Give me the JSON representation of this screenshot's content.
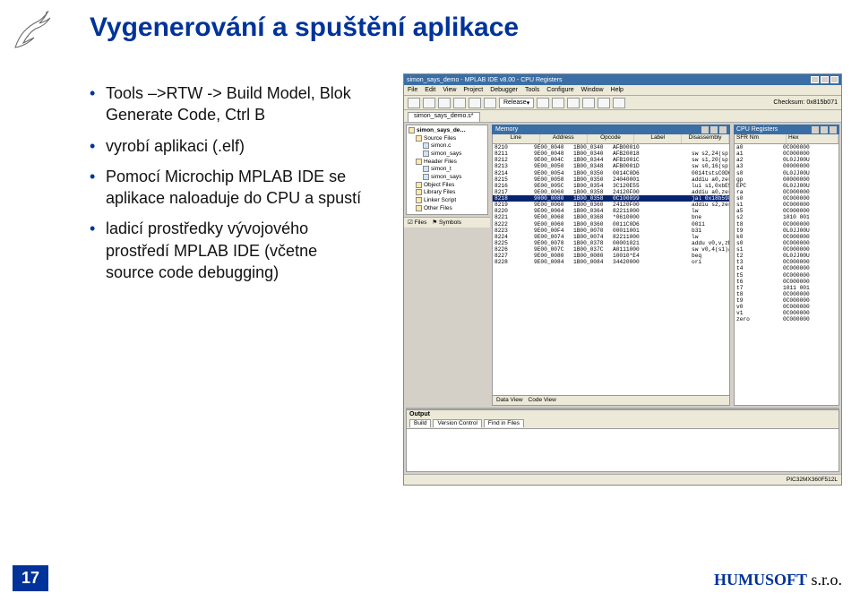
{
  "title": "Vygenerování a spuštění aplikace",
  "bullets": [
    "Tools –>RTW -> Build Model, Blok Generate Code, Ctrl B",
    "vyrobí aplikaci (.elf)",
    "Pomocí Microchip MPLAB IDE se aplikace naloaduje do CPU a spustí",
    "ladicí prostředky vývojového prostředí MPLAB IDE (včetne source code debugging)"
  ],
  "page_number": "17",
  "brand_main": "HUMUSOFT",
  "brand_suffix": " s.r.o.",
  "ide": {
    "window_title": "simon_says_demo - MPLAB IDE v8.00 - CPU Registers",
    "menu": [
      "File",
      "Edit",
      "View",
      "Project",
      "Debugger",
      "Tools",
      "Configure",
      "Window",
      "Help"
    ],
    "toolbar_combo": "Release",
    "checksum_label": "Checksum: 0x815b071",
    "doc_tab": "simon_says_demo.s*",
    "tree_tabs": [
      "Files",
      "Symbols"
    ],
    "tree": [
      "simon_says_de…",
      "Source Files",
      "simon.c",
      "simon_says",
      "Header Files",
      "simon_t",
      "simon_says",
      "Object Files",
      "Library Files",
      "Linker Script",
      "Other Files"
    ],
    "mem": {
      "title": "Memory",
      "headers": [
        "Line",
        "Address",
        "Opcode",
        "Label",
        "Disassembly"
      ],
      "rows": [
        [
          "8210",
          "9E00_0040",
          "1B00_0340",
          "AFB00010",
          "",
          ""
        ],
        [
          "8211",
          "9E00_0048",
          "1B00_0340",
          "AFB20018",
          "",
          "sw  s2,24(sp)"
        ],
        [
          "8212",
          "9E00_004C",
          "1B00_0344",
          "AFB1001C",
          "",
          "sw  s1,20(sp)"
        ],
        [
          "8213",
          "9E00_0050",
          "1B00_0348",
          "AFB0001D",
          "",
          "sw  s0,16(sp)"
        ],
        [
          "8214",
          "9E00_0054",
          "1B00_0350",
          "0014C0D6",
          "",
          "0014tstsC0D6"
        ],
        [
          "8215",
          "9E00_0058",
          "1B00_0350",
          "24040001",
          "",
          "addiu a0,zero,1"
        ],
        [
          "8216",
          "9E00_005C",
          "1B00_0354",
          "3C120E55",
          "",
          "lui  s1,0xbE55"
        ],
        [
          "8217",
          "9E00_0060",
          "1B00_0358",
          "24120F00",
          "",
          "addiu a0,zero,…?"
        ],
        [
          "8218",
          "9000_0080",
          "1B00_0358",
          "0C100899",
          "",
          "jal  0x18b598"
        ],
        [
          "8219",
          "9E00_0060",
          "1B00_0360",
          "24120F00",
          "",
          "addiu s2,zero,…0"
        ],
        [
          "8220",
          "9E00_0064",
          "1B00_0364",
          "82211000",
          "",
          "lw"
        ],
        [
          "8221",
          "9E00_0068",
          "1B00_0368",
          "*0610000",
          "",
          "bne"
        ],
        [
          "8222",
          "9E00_0060",
          "1B00_0360",
          "0011C0D6",
          "",
          "0011"
        ],
        [
          "8223",
          "9E00_00F4",
          "1B00_0070",
          "00011001",
          "",
          "b31"
        ],
        [
          "8224",
          "9E00_0074",
          "1B00_0074",
          "82211000",
          "",
          "lw"
        ],
        [
          "8225",
          "9E00_0078",
          "1B00_0378",
          "00001021",
          "",
          "addu v0,v,zE"
        ],
        [
          "8226",
          "9E00_007C",
          "1B00_037C",
          "A0111000",
          "",
          "sw  v0,4(s1)aE"
        ],
        [
          "8227",
          "9E00_0080",
          "1B00_0080",
          "10010*E4",
          "",
          "beq"
        ],
        [
          "8228",
          "9E00_0084",
          "1B00_0084",
          "34420000",
          "",
          "ori"
        ]
      ],
      "selected_index": 8,
      "tabs": [
        "Data View",
        "Code View"
      ]
    },
    "regs": {
      "title": "CPU Registers",
      "headers": [
        "SFR Nm",
        "Hex"
      ],
      "rows": [
        [
          "a0",
          "0C000000"
        ],
        [
          "a1",
          "0C000000"
        ],
        [
          "a2",
          "0L0JJ00U"
        ],
        [
          "a3",
          "00000000"
        ],
        [
          "s0",
          "0L0JJ00U"
        ],
        [
          "gp",
          "00000000"
        ],
        [
          "EPC",
          "0L0JJ00U"
        ],
        [
          "ra",
          "0C000000"
        ],
        [
          "s0",
          "0C000000"
        ],
        [
          "s1",
          "0C000000"
        ],
        [
          "a5",
          "0C000000"
        ],
        [
          "s2",
          "1010 001"
        ],
        [
          "t8",
          "0C000000"
        ],
        [
          "t9",
          "0L0JJ00U"
        ],
        [
          "k0",
          "0C000000"
        ],
        [
          "s0",
          "0C000000"
        ],
        [
          "s1",
          "0C000000"
        ],
        [
          "t2",
          "0L0JJ00U"
        ],
        [
          "t3",
          "0C000000"
        ],
        [
          "t4",
          "0C000000"
        ],
        [
          "t5",
          "0C000000"
        ],
        [
          "t6",
          "0C000000"
        ],
        [
          "t7",
          "1011 001"
        ],
        [
          "t8",
          "0C000000"
        ],
        [
          "t9",
          "0C000000"
        ],
        [
          "v0",
          "0C000000"
        ],
        [
          "v1",
          "0C000000"
        ],
        [
          "zero",
          "0C000000"
        ]
      ]
    },
    "output": {
      "title": "Output",
      "tabs": [
        "Build",
        "Version Control",
        "Find in Files"
      ]
    },
    "status": "PIC32MX360F512L"
  }
}
